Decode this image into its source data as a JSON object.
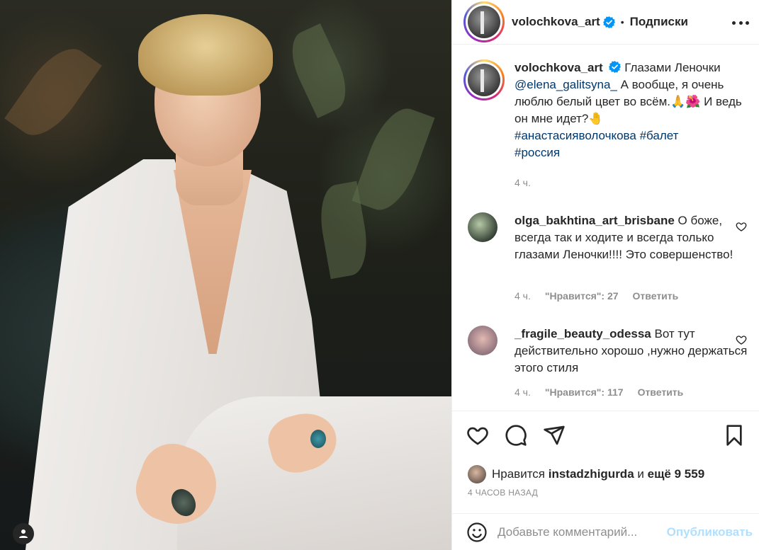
{
  "post": {
    "author": "volochkova_art",
    "follow_label": "Подписки",
    "separator": "•"
  },
  "caption": {
    "author": "volochkova_art",
    "text_1": "Глазами Леночки",
    "mention": "@elena_galitsyna_",
    "text_2": "А вообще, я очень люблю белый цвет во всём.🙏🌺 И ведь он мне идет?🤚",
    "hashtags": [
      "#анастасияволочкова",
      "#балет",
      "#россия"
    ],
    "time": "4 ч."
  },
  "comments": [
    {
      "user": "olga_bakhtina_art_brisbane",
      "text": "О боже, всегда так и ходите и всегда только глазами Леночки!!!! Это совершенство!",
      "time": "4 ч.",
      "likes": "\"Нравится\": 27",
      "reply": "Ответить"
    },
    {
      "user": "_fragile_beauty_odessa",
      "text": "Вот тут действительно хорошо ,нужно держаться этого стиля",
      "time": "4 ч.",
      "likes": "\"Нравится\": 117",
      "reply": "Ответить"
    }
  ],
  "likes": {
    "prefix": "Нравится",
    "user": "instadzhigurda",
    "middle": "и",
    "rest": "ещё 9 559"
  },
  "posted_ago": "4 ЧАСОВ НАЗАД",
  "comment_box": {
    "placeholder": "Добавьте комментарий...",
    "publish_label": "Опубликовать"
  },
  "colors": {
    "verified": "#0095f6",
    "link": "#00376b",
    "muted": "#8e8e8e",
    "publish_disabled": "#b2dffc"
  },
  "icons": [
    "heart-icon",
    "comment-icon",
    "share-icon",
    "bookmark-icon",
    "emoji-icon",
    "more-icon",
    "verified-icon",
    "user-icon"
  ]
}
